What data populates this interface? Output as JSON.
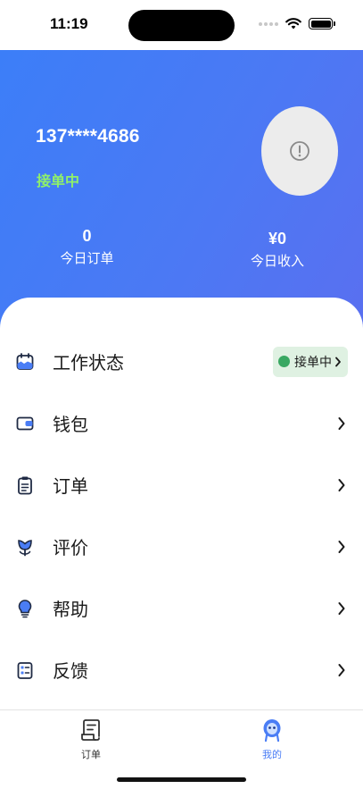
{
  "status_bar": {
    "time": "11:19"
  },
  "profile": {
    "phone": "137****4686",
    "work_status": "接单中",
    "avatar_icon": "alert-circle-icon"
  },
  "stats": [
    {
      "value": "0",
      "label": "今日订单"
    },
    {
      "value": "¥0",
      "label": "今日收入"
    }
  ],
  "menu": [
    {
      "label": "工作状态",
      "icon": "work-status-icon",
      "badge": "接单中"
    },
    {
      "label": "钱包",
      "icon": "wallet-icon"
    },
    {
      "label": "订单",
      "icon": "clipboard-icon"
    },
    {
      "label": "评价",
      "icon": "flower-icon"
    },
    {
      "label": "帮助",
      "icon": "lightbulb-icon"
    },
    {
      "label": "反馈",
      "icon": "checklist-icon"
    }
  ],
  "tabbar": [
    {
      "label": "订单",
      "icon": "order-scroll-icon",
      "active": false
    },
    {
      "label": "我的",
      "icon": "robot-avatar-icon",
      "active": true
    }
  ],
  "colors": {
    "hero_start": "#3c7ef8",
    "hero_end": "#5a6ff0",
    "status_green": "#8ff06a",
    "badge_bg": "#dff1e2",
    "badge_dot": "#39a862",
    "accent": "#4a7df5",
    "tab_inactive": "#333333"
  }
}
